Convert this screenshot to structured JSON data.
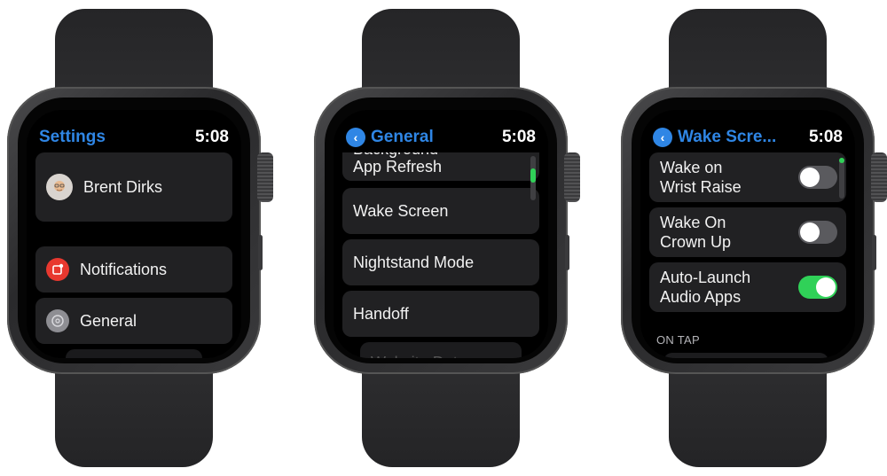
{
  "watches": [
    {
      "screen": {
        "title": "Settings",
        "time": "5:08",
        "profile": {
          "name": "Brent Dirks",
          "avatar_icon": "memoji-avatar-icon"
        },
        "items": [
          {
            "label": "Notifications",
            "icon": "notifications-icon",
            "icon_color": "#e8382f"
          },
          {
            "label": "General",
            "icon": "gear-icon",
            "icon_color": "#8e8e93"
          }
        ]
      }
    },
    {
      "screen": {
        "back_icon": "chevron-left-icon",
        "title": "General",
        "time": "5:08",
        "items": [
          {
            "label": "Background App Refresh",
            "label_line1": "Background",
            "label_line2": "App Refresh"
          },
          {
            "label": "Wake Screen"
          },
          {
            "label": "Nightstand Mode"
          },
          {
            "label": "Handoff"
          },
          {
            "label": "Website Data"
          }
        ]
      }
    },
    {
      "screen": {
        "back_icon": "chevron-left-icon",
        "title": "Wake Scre...",
        "time": "5:08",
        "toggles": [
          {
            "label_line1": "Wake on",
            "label_line2": "Wrist Raise",
            "on": false
          },
          {
            "label_line1": "Wake On",
            "label_line2": "Crown Up",
            "on": false
          },
          {
            "label_line1": "Auto-Launch",
            "label_line2": "Audio Apps",
            "on": true
          }
        ],
        "section_header": "ON TAP"
      }
    }
  ],
  "colors": {
    "accent": "#2f86e5",
    "toggle_on": "#30d158",
    "notifications": "#e8382f"
  }
}
